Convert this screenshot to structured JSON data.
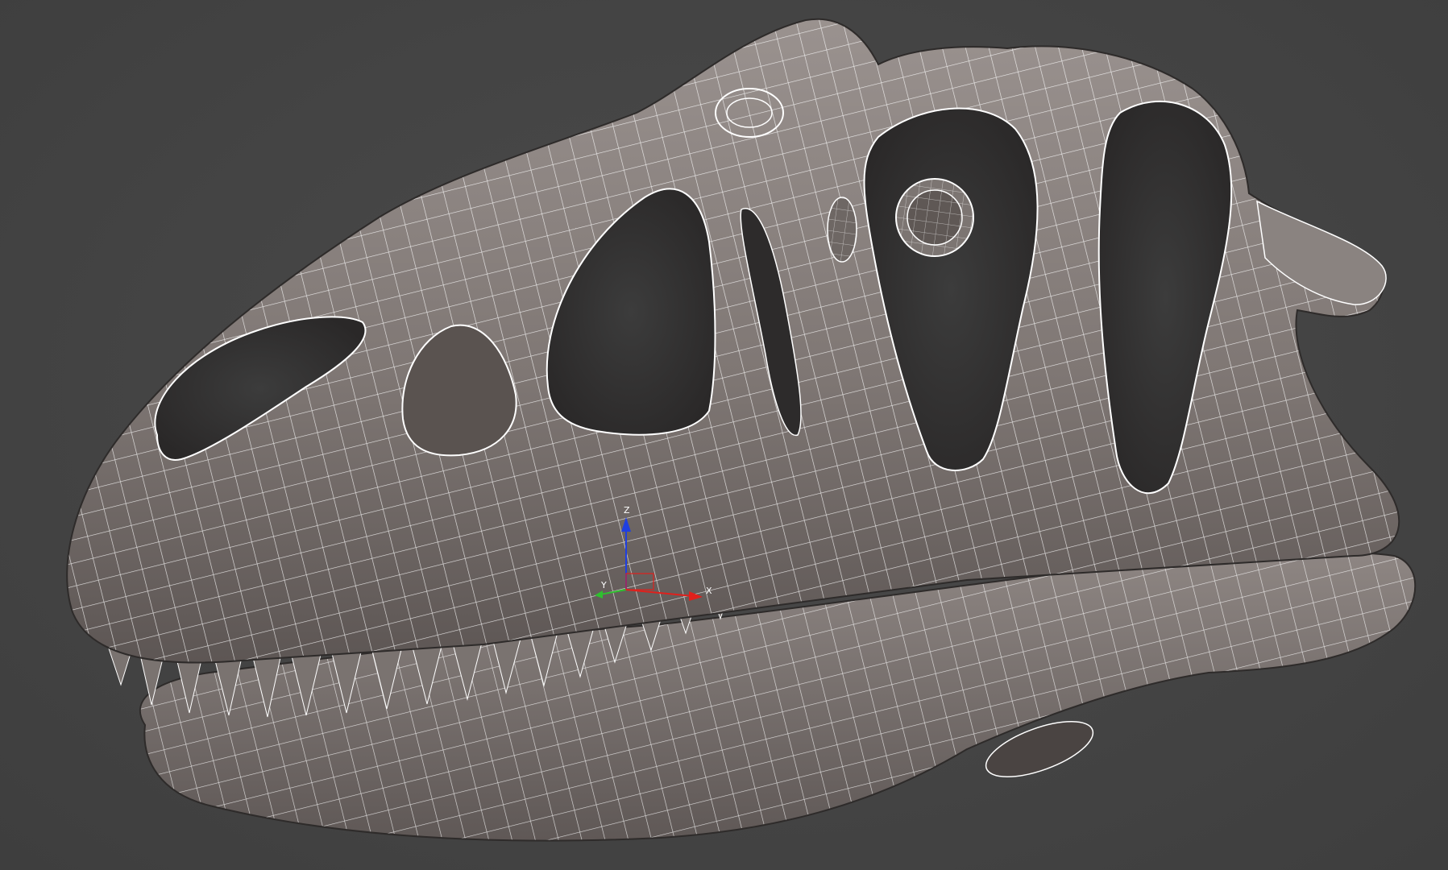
{
  "viewport": {
    "background_color": "#444444",
    "mesh_color": "#8a8380",
    "wire_color": "#ffffff",
    "subject": "dinosaur-skull-wireframe-model"
  },
  "gizmo": {
    "x_label": "X",
    "y_label": "Y",
    "z_label": "Z",
    "x_color": "#e0201c",
    "y_color": "#2fbf2f",
    "z_color": "#1f3fe0"
  }
}
